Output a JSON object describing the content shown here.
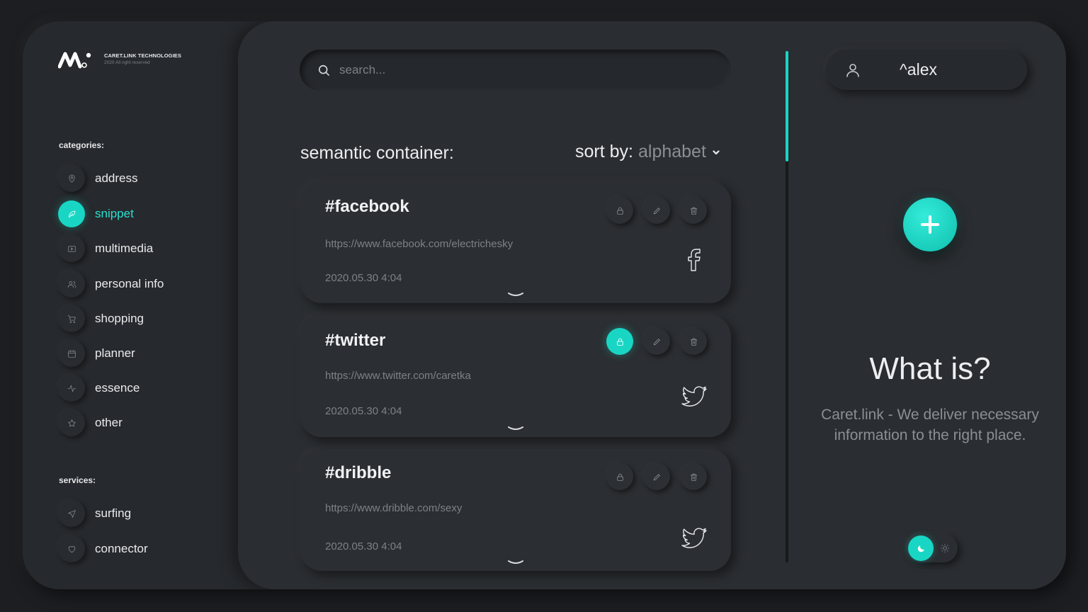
{
  "brand": {
    "logo_icon": "caret-link-logo",
    "company": "CARET.LINK TECHNOLOGIES",
    "copyright": "2020 All right reserved"
  },
  "sidebar": {
    "categories_label": "categories:",
    "categories": [
      {
        "label": "address",
        "icon": "map-pin-icon",
        "active": false
      },
      {
        "label": "snippet",
        "icon": "feather-icon",
        "active": true
      },
      {
        "label": "multimedia",
        "icon": "video-icon",
        "active": false
      },
      {
        "label": "personal info",
        "icon": "users-icon",
        "active": false
      },
      {
        "label": "shopping",
        "icon": "cart-icon",
        "active": false
      },
      {
        "label": "planner",
        "icon": "calendar-icon",
        "active": false
      },
      {
        "label": "essence",
        "icon": "activity-icon",
        "active": false
      },
      {
        "label": "other",
        "icon": "star-icon",
        "active": false
      }
    ],
    "services_label": "services:",
    "services": [
      {
        "label": "surfing",
        "icon": "navigation-icon"
      },
      {
        "label": "connector",
        "icon": "heart-icon"
      }
    ]
  },
  "search": {
    "placeholder": "search..."
  },
  "main": {
    "title": "semantic container:",
    "sort_label": "sort by:",
    "sort_value": "alphabet"
  },
  "cards": [
    {
      "title": "#facebook",
      "url": "https://www.facebook.com/electrichesky",
      "date": "2020.05.30 4:04",
      "locked": false,
      "brand_icon": "facebook-icon"
    },
    {
      "title": "#twitter",
      "url": "https://www.twitter.com/caretka",
      "date": "2020.05.30 4:04",
      "locked": true,
      "brand_icon": "twitter-icon"
    },
    {
      "title": "#dribble",
      "url": "https://www.dribble.com/sexy",
      "date": "2020.05.30 4:04",
      "locked": false,
      "brand_icon": "twitter-icon"
    }
  ],
  "user": {
    "name": "^alex",
    "icon": "user-icon"
  },
  "info": {
    "title": "What is?",
    "text": "Caret.link - We deliver necessary information to the right place."
  },
  "theme": {
    "mode": "dark",
    "accent": "#19d6c4",
    "background": "#26292d"
  }
}
